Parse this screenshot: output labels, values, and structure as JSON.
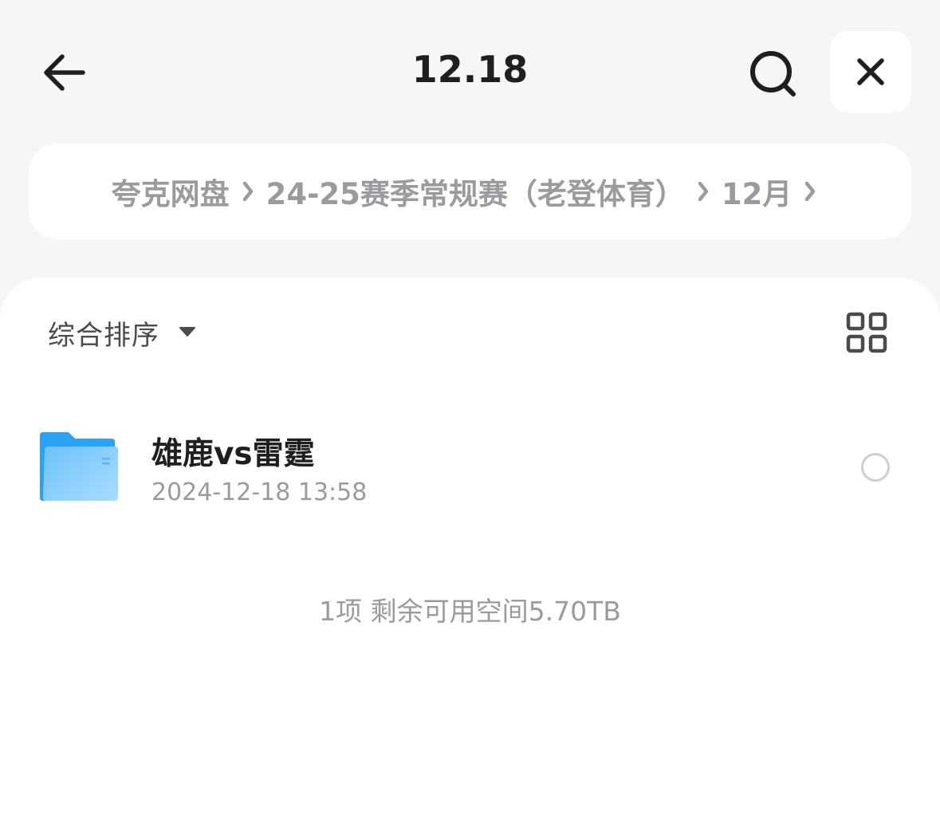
{
  "header": {
    "title": "12.18",
    "back_icon": "arrow-left-icon",
    "search_icon": "search-icon",
    "close_icon": "close-icon"
  },
  "breadcrumb": {
    "items": [
      "夸克网盘",
      "24-25赛季常规赛（老登体育）",
      "12月"
    ]
  },
  "toolbar": {
    "sort_label": "综合排序",
    "view_icon": "grid-view-icon"
  },
  "files": [
    {
      "name": "雄鹿vs雷霆",
      "date": "2024-12-18 13:58",
      "type": "folder"
    }
  ],
  "footer": {
    "summary": "1项 剩余可用空间5.70TB"
  },
  "colors": {
    "background": "#f6f6f7",
    "panel": "#ffffff",
    "folder_blue": "#2aa3f5",
    "text_primary": "#1f1f22",
    "text_secondary": "#9a9a9f"
  }
}
